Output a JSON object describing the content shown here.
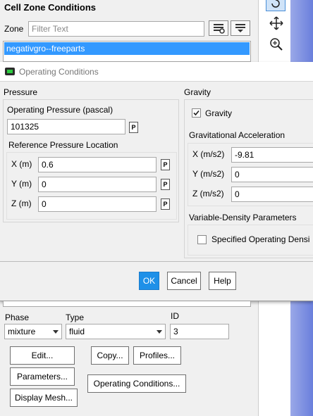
{
  "cell_zone": {
    "title": "Cell Zone Conditions",
    "zone_label": "Zone",
    "filter_placeholder": "Filter Text",
    "selected_zone": "negativgro--freeparts"
  },
  "dialog": {
    "title": "Operating Conditions",
    "pressure": {
      "section_label": "Pressure",
      "op_pressure_label": "Operating Pressure (pascal)",
      "op_pressure_value": "101325",
      "ref_location_label": "Reference Pressure Location",
      "x_label": "X (m)",
      "x_value": "0.6",
      "y_label": "Y (m)",
      "y_value": "0",
      "z_label": "Z (m)",
      "z_value": "0"
    },
    "gravity": {
      "section_label": "Gravity",
      "checkbox_label": "Gravity",
      "accel_label": "Gravitational Acceleration",
      "x_label": "X (m/s2)",
      "x_value": "-9.81",
      "y_label": "Y (m/s2)",
      "y_value": "0",
      "z_label": "Z (m/s2)",
      "z_value": "0",
      "var_density_label": "Variable-Density Parameters",
      "specified_label": "Specified Operating Densi"
    },
    "p_marker": "P",
    "buttons": {
      "ok": "OK",
      "cancel": "Cancel",
      "help": "Help"
    }
  },
  "bottom": {
    "phase_label": "Phase",
    "phase_value": "mixture",
    "type_label": "Type",
    "type_value": "fluid",
    "id_label": "ID",
    "id_value": "3",
    "buttons": {
      "edit": "Edit...",
      "copy": "Copy...",
      "profiles": "Profiles...",
      "parameters": "Parameters...",
      "operating_conditions": "Operating Conditions...",
      "display_mesh": "Display Mesh..."
    }
  },
  "colors": {
    "accent": "#1e90e8",
    "selection": "#3399ff",
    "viewport": "#6a7fdc"
  }
}
